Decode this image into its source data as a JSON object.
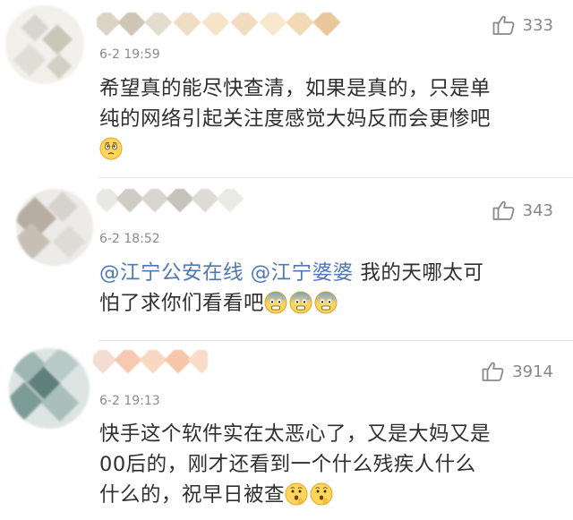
{
  "comments": [
    {
      "time": "6-2 19:59",
      "likes": "333",
      "lines": [
        "希望真的能尽快查清，如果是真的，只是单",
        "纯的网络引起关注度感觉大妈反而会更惨吧"
      ],
      "emoji_line": [
        "worried-face-emoji"
      ]
    },
    {
      "time": "6-2 18:52",
      "likes": "343",
      "mention_1": "@江宁公安在线",
      "mention_2": "@江宁婆婆",
      "text_1": "我的天哪太可",
      "line2": "怕了求你们看看吧",
      "emojis": [
        "fearful-sweat-emoji",
        "fearful-sweat-emoji",
        "fearful-sweat-emoji"
      ]
    },
    {
      "time": "6-2 19:13",
      "likes": "3914",
      "lines": [
        "快手这个软件实在太恶心了，又是大妈又是",
        "00后的，刚才还看到一个什么残疾人什么"
      ],
      "last_line": "什么的，祝早日被查",
      "emojis": [
        "hushed-face-emoji",
        "hushed-face-emoji"
      ]
    }
  ],
  "colors": {
    "mention": "#4e78b5",
    "meta": "#8a8a8a",
    "text": "#2f2f2f",
    "divider": "#e6e6e6"
  },
  "icons": {
    "like": "thumbs-up-icon"
  }
}
